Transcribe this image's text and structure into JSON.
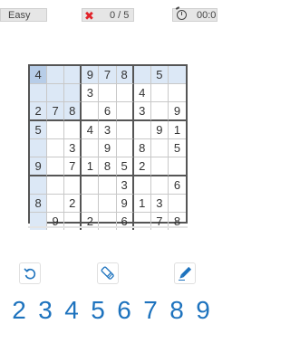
{
  "header": {
    "difficulty": "Easy",
    "mistakes": "0 / 5",
    "timer": "00:0"
  },
  "board": {
    "selected": [
      0,
      0
    ],
    "highlight_color": "#dce8f6",
    "selected_color": "#b7cde8",
    "rows": [
      [
        "4",
        "",
        "",
        "9",
        "7",
        "8",
        "",
        "5",
        ""
      ],
      [
        "",
        "",
        "",
        "3",
        "",
        "",
        "4",
        "",
        ""
      ],
      [
        "2",
        "7",
        "8",
        "",
        "6",
        "",
        "3",
        "",
        "9"
      ],
      [
        "5",
        "",
        "",
        "4",
        "3",
        "",
        "",
        "9",
        "1"
      ],
      [
        "",
        "",
        "3",
        "",
        "9",
        "",
        "8",
        "",
        "5"
      ],
      [
        "9",
        "",
        "7",
        "1",
        "8",
        "5",
        "2",
        "",
        ""
      ],
      [
        "",
        "",
        "",
        "",
        "",
        "3",
        "",
        "",
        "6"
      ],
      [
        "8",
        "",
        "2",
        "",
        "",
        "9",
        "1",
        "3",
        ""
      ],
      [
        "",
        "9",
        "",
        "2",
        "",
        "6",
        "",
        "7",
        "8"
      ]
    ]
  },
  "tools": [
    {
      "name": "undo-icon"
    },
    {
      "name": "eraser-icon"
    },
    {
      "name": "pencil-icon"
    }
  ],
  "numpad": [
    "2",
    "3",
    "4",
    "5",
    "6",
    "7",
    "8",
    "9"
  ],
  "colors": {
    "accent": "#1e73be",
    "mistake": "#e2232a"
  }
}
